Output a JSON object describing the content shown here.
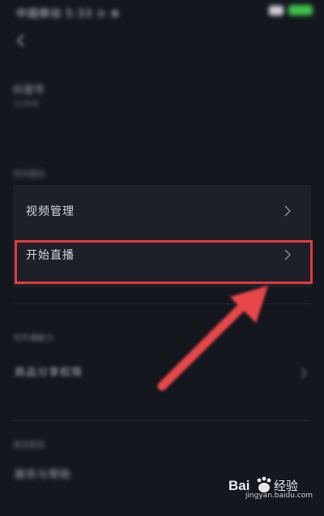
{
  "status_bar": {
    "left_text": "中国移动 5:33 ⊙ ⊗",
    "icons": [
      "signal-icon",
      "battery-icon"
    ]
  },
  "header": {
    "back_icon": "chevron-left-icon"
  },
  "profile": {
    "name": "抖音号",
    "sub": "12345"
  },
  "section_creator": {
    "label": "创作服务"
  },
  "menu": {
    "items": [
      {
        "label": "视频管理",
        "icon": "chevron-right-icon"
      },
      {
        "label": "开始直播",
        "icon": "chevron-right-icon",
        "highlighted": true
      }
    ]
  },
  "section_open": {
    "label": "可开通能力"
  },
  "capability_item": {
    "label": "商品分享权限"
  },
  "section_more": {
    "label": "更多服务"
  },
  "more_item": {
    "label": "服务与帮助"
  },
  "watermark": {
    "url": "jingyan.baidu.com"
  },
  "colors": {
    "background": "#15171f",
    "card": "#1e2029",
    "highlight": "#e23b3e",
    "arrow": "#e8464a"
  }
}
